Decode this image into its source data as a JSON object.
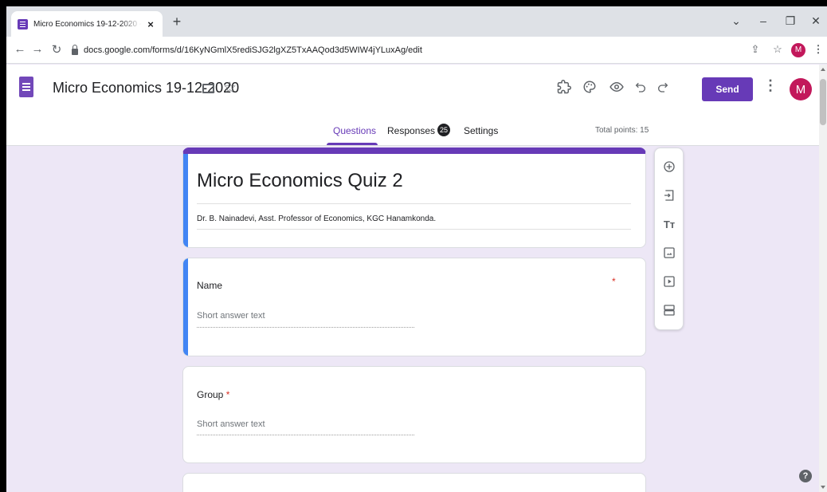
{
  "browser": {
    "tab_title": "Micro Economics 19-12-2020 - G",
    "tab_close": "×",
    "new_tab": "+",
    "url": "docs.google.com/forms/d/16KyNGmlX5rediSJG2lgXZ5TxAAQod3d5WIW4jYLuxAg/edit",
    "profile_initial": "M",
    "icons": {
      "back": "arrow-left-icon",
      "forward": "arrow-right-icon",
      "reload": "reload-icon",
      "lock": "lock-icon",
      "share": "share-icon",
      "bookmark": "star-icon",
      "menu": "kebab-icon"
    }
  },
  "window_controls": {
    "tab_search": "⌄",
    "minimize": "–",
    "restore": "❐",
    "close": "✕"
  },
  "header": {
    "title": "Micro Economics 19-12-2020",
    "send_label": "Send",
    "avatar_initial": "M",
    "accent_color": "#673ab7",
    "icons": [
      "add-ons-icon",
      "palette-icon",
      "preview-eye-icon",
      "undo-icon",
      "redo-icon",
      "more-icon"
    ]
  },
  "tabs": {
    "questions": "Questions",
    "responses": "Responses",
    "responses_count": "25",
    "settings": "Settings",
    "total_points": "Total points: 15"
  },
  "form": {
    "title": "Micro Economics Quiz 2",
    "description": "Dr. B. Nainadevi, Asst. Professor of Economics, KGC Hanamkonda.",
    "questions": [
      {
        "label": "Name",
        "required_mark": "*",
        "placeholder": "Short answer text"
      },
      {
        "label": "Group",
        "required_mark": "*",
        "placeholder": "Short answer text"
      }
    ]
  },
  "side_toolbar": {
    "icons": [
      "add-question-icon",
      "import-questions-icon",
      "add-title-icon",
      "add-image-icon",
      "add-video-icon",
      "add-section-icon"
    ],
    "title_glyph": "Tт"
  },
  "help": "?"
}
